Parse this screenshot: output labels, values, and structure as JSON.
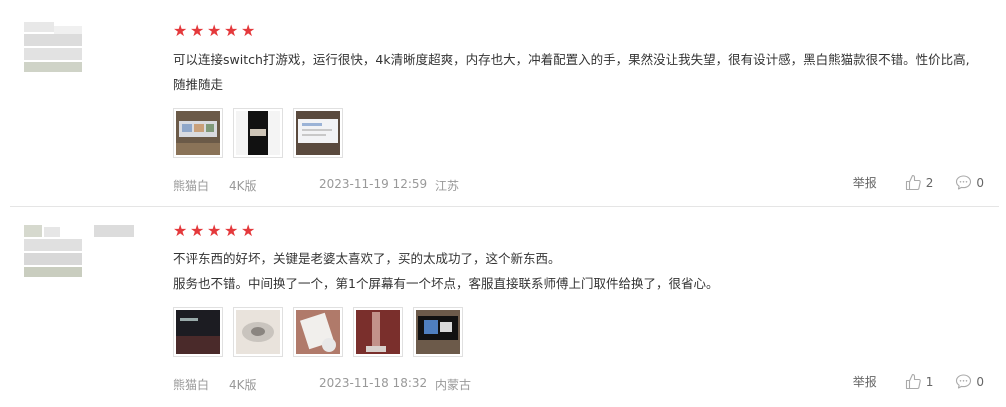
{
  "reviews": [
    {
      "rating": 5,
      "text_lines": [
        "可以连接switch打游戏，运行很快，4k清晰度超爽，内存也大，冲着配置入的手，果然没让我失望，很有设计感，黑白熊猫款很不错。性价比高,随推随走"
      ],
      "variant": "熊猫白",
      "spec": "4K版",
      "date": "2023-11-19 12:59",
      "location": "江苏",
      "report_label": "举报",
      "likes": "2",
      "comments": "0"
    },
    {
      "rating": 5,
      "text_lines": [
        "不评东西的好坏，关键是老婆太喜欢了，买的太成功了，这个新东西。",
        "服务也不错。中间换了一个，第1个屏幕有一个坏点，客服直接联系师傅上门取件给换了，很省心。"
      ],
      "variant": "熊猫白",
      "spec": "4K版",
      "date": "2023-11-18 18:32",
      "location": "内蒙古",
      "report_label": "举报",
      "likes": "1",
      "comments": "0"
    }
  ],
  "colors": {
    "star": "#e4393c",
    "meta_text": "#999999",
    "body_text": "#333333"
  },
  "icons": {
    "star": "star-icon",
    "like": "thumbs-up-icon",
    "comment": "comment-bubble-icon"
  }
}
